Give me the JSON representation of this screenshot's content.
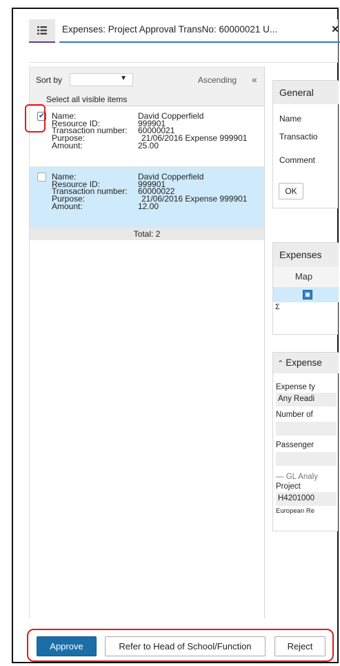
{
  "tab": {
    "title": "Expenses: Project Approval TransNo: 60000021 U...",
    "close": "✕"
  },
  "list": {
    "sort_label": "Sort by",
    "sort_value": "",
    "order_label": "Ascending",
    "collapse_glyph": "«",
    "select_all_label": "Select all visible items",
    "field_labels": [
      "Name:",
      "Resource ID:",
      "Transaction number:",
      "Purpose:",
      "Amount:"
    ],
    "items": [
      {
        "checked": true,
        "name": "David Copperfield",
        "resource_id": "999901",
        "transaction_number": "60000021",
        "purpose": "21/06/2016 Expense 999901",
        "amount": "25.00"
      },
      {
        "checked": false,
        "name": "David Copperfield",
        "resource_id": "999901",
        "transaction_number": "60000022",
        "purpose": "21/06/2016 Expense 999901",
        "amount": "12.00"
      }
    ],
    "total": "Total: 2"
  },
  "general": {
    "title": "General",
    "labels": [
      "Name",
      "Transactio",
      "Comment"
    ],
    "ok": "OK"
  },
  "expenses": {
    "title": "Expenses",
    "column": "Map",
    "sigma": "Σ"
  },
  "expense_details": {
    "title": "Expense",
    "collapse_glyph": "⌃",
    "expense_type_label": "Expense ty",
    "expense_type_value": "Any Readi",
    "number_label": "Number of",
    "number_value": "",
    "passenger_label": "Passenger",
    "passenger_value": "",
    "gl_label": "GL Analy",
    "project_label": "Project",
    "project_value": "H4201000",
    "project_desc": "European Re"
  },
  "actions": {
    "approve": "Approve",
    "refer": "Refer to Head of School/Function",
    "reject": "Reject"
  },
  "colors": {
    "accent": "#1b6ea7",
    "selection": "#cfeafb",
    "highlight": "#e01b1b"
  }
}
